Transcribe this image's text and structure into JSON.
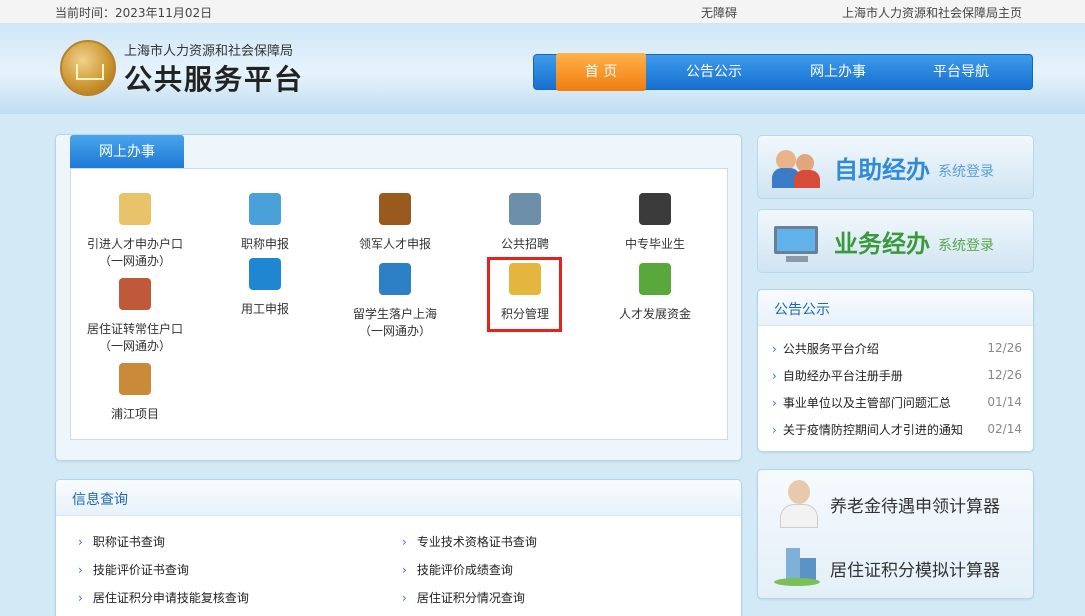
{
  "topbar": {
    "date_label": "当前时间：",
    "date": "2023年11月02日",
    "accessibility": "无障碍",
    "home_link": "上海市人力资源和社会保障局主页"
  },
  "header": {
    "subtitle": "上海市人力资源和社会保障局",
    "title": "公共服务平台"
  },
  "nav": [
    "首 页",
    "公告公示",
    "网上办事",
    "平台导航"
  ],
  "services": {
    "tab": "网上办事",
    "items": [
      {
        "label1": "引进人才申办户口",
        "label2": "（一网通办）",
        "icon": "envelope-folder-icon",
        "color": "#e9c36a"
      },
      {
        "label1": "职称申报",
        "label2": "",
        "icon": "document-pen-icon",
        "color": "#4aa0d8"
      },
      {
        "label1": "领军人才申报",
        "label2": "",
        "icon": "briefcase-icon",
        "color": "#9a5a1d"
      },
      {
        "label1": "公共招聘",
        "label2": "",
        "icon": "recruit-person-icon",
        "color": "#6c8ea8"
      },
      {
        "label1": "中专毕业生",
        "label2": "",
        "icon": "graduate-icon",
        "color": "#3b3b3b"
      },
      {
        "label1": "居住证转常住户口",
        "label2": "（一网通办）",
        "icon": "people-icon",
        "color": "#c0593a"
      },
      {
        "label1": "用工申报",
        "label2": "",
        "icon": "list-book-icon",
        "color": "#1f86d1"
      },
      {
        "label1": "留学生落户上海",
        "label2": "（一网通办）",
        "icon": "documents-stack-icon",
        "color": "#2d7fc6"
      },
      {
        "label1": "积分管理",
        "label2": "",
        "icon": "database-icon",
        "color": "#e4b63d"
      },
      {
        "label1": "人才发展资金",
        "label2": "",
        "icon": "money-icon",
        "color": "#58a83c"
      },
      {
        "label1": "浦江项目",
        "label2": "",
        "icon": "house-arrow-icon",
        "color": "#c98b3a"
      }
    ]
  },
  "banners": [
    {
      "main": "自助经办",
      "sub": "系统登录"
    },
    {
      "main": "业务经办",
      "sub": "系统登录"
    }
  ],
  "notice": {
    "title": "公告公示",
    "items": [
      {
        "text": "公共服务平台介绍",
        "date": "12/26"
      },
      {
        "text": "自助经办平台注册手册",
        "date": "12/26"
      },
      {
        "text": "事业单位以及主管部门问题汇总",
        "date": "01/14"
      },
      {
        "text": "关于疫情防控期间人才引进的通知",
        "date": "02/14"
      }
    ]
  },
  "calculators": [
    "养老金待遇申领计算器",
    "居住证积分模拟计算器"
  ],
  "info": {
    "title": "信息查询",
    "links": [
      "职称证书查询",
      "专业技术资格证书查询",
      "技能评价证书查询",
      "技能评价成绩查询",
      "居住证积分申请技能复核查询",
      "居住证积分情况查询"
    ]
  },
  "colors": {
    "accent": "#1c78d4",
    "nav_active": "#f07d0f",
    "highlight": "#e5231c"
  }
}
